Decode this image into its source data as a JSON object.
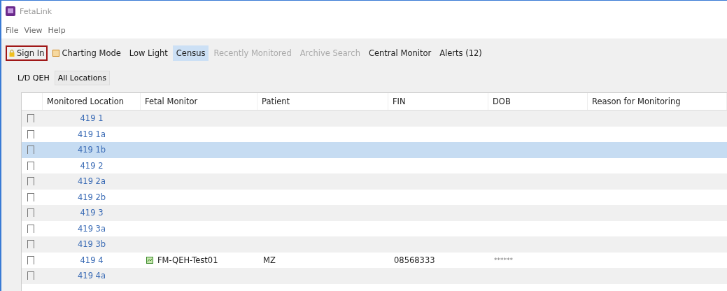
{
  "window": {
    "title": "FetaLink"
  },
  "menu": [
    "File",
    "View",
    "Help"
  ],
  "toolbar": [
    {
      "label": "Sign In",
      "kind": "icon",
      "selected": false,
      "disabled": false,
      "highlighted": true
    },
    {
      "label": "Charting Mode",
      "kind": "icon",
      "selected": false,
      "disabled": false,
      "highlighted": false
    },
    {
      "label": "Low Light",
      "kind": "text",
      "selected": false,
      "disabled": false,
      "highlighted": false
    },
    {
      "label": "Census",
      "kind": "text",
      "selected": true,
      "disabled": false,
      "highlighted": false
    },
    {
      "label": "Recently Monitored",
      "kind": "text",
      "selected": false,
      "disabled": true,
      "highlighted": false
    },
    {
      "label": "Archive Search",
      "kind": "text",
      "selected": false,
      "disabled": true,
      "highlighted": false
    },
    {
      "label": "Central Monitor",
      "kind": "text",
      "selected": false,
      "disabled": false,
      "highlighted": false
    },
    {
      "label": "Alerts (12)",
      "kind": "text",
      "selected": false,
      "disabled": false,
      "highlighted": false
    }
  ],
  "tabs": [
    {
      "label": "L/D QEH",
      "selected": true
    },
    {
      "label": "All Locations",
      "selected": false
    }
  ],
  "table": {
    "columns": [
      "Monitored Location",
      "Fetal Monitor",
      "Patient",
      "FIN",
      "DOB",
      "Reason for Monitoring"
    ],
    "rows": [
      {
        "location": "419 1",
        "checked": false,
        "selected": false
      },
      {
        "location": "419 1a",
        "checked": false,
        "selected": false
      },
      {
        "location": "419 1b",
        "checked": false,
        "selected": true
      },
      {
        "location": "419 2",
        "checked": false,
        "selected": false
      },
      {
        "location": "419 2a",
        "checked": false,
        "selected": false
      },
      {
        "location": "419 2b",
        "checked": false,
        "selected": false
      },
      {
        "location": "419 3",
        "checked": false,
        "selected": false
      },
      {
        "location": "419 3a",
        "checked": false,
        "selected": false
      },
      {
        "location": "419 3b",
        "checked": false,
        "selected": false
      },
      {
        "location": "419 4",
        "checked": false,
        "selected": false,
        "monitor": "FM-QEH-Test01",
        "patient": "MZ",
        "fin": "08568333",
        "dob": "******"
      },
      {
        "location": "419 4a",
        "checked": false,
        "selected": false
      }
    ]
  }
}
